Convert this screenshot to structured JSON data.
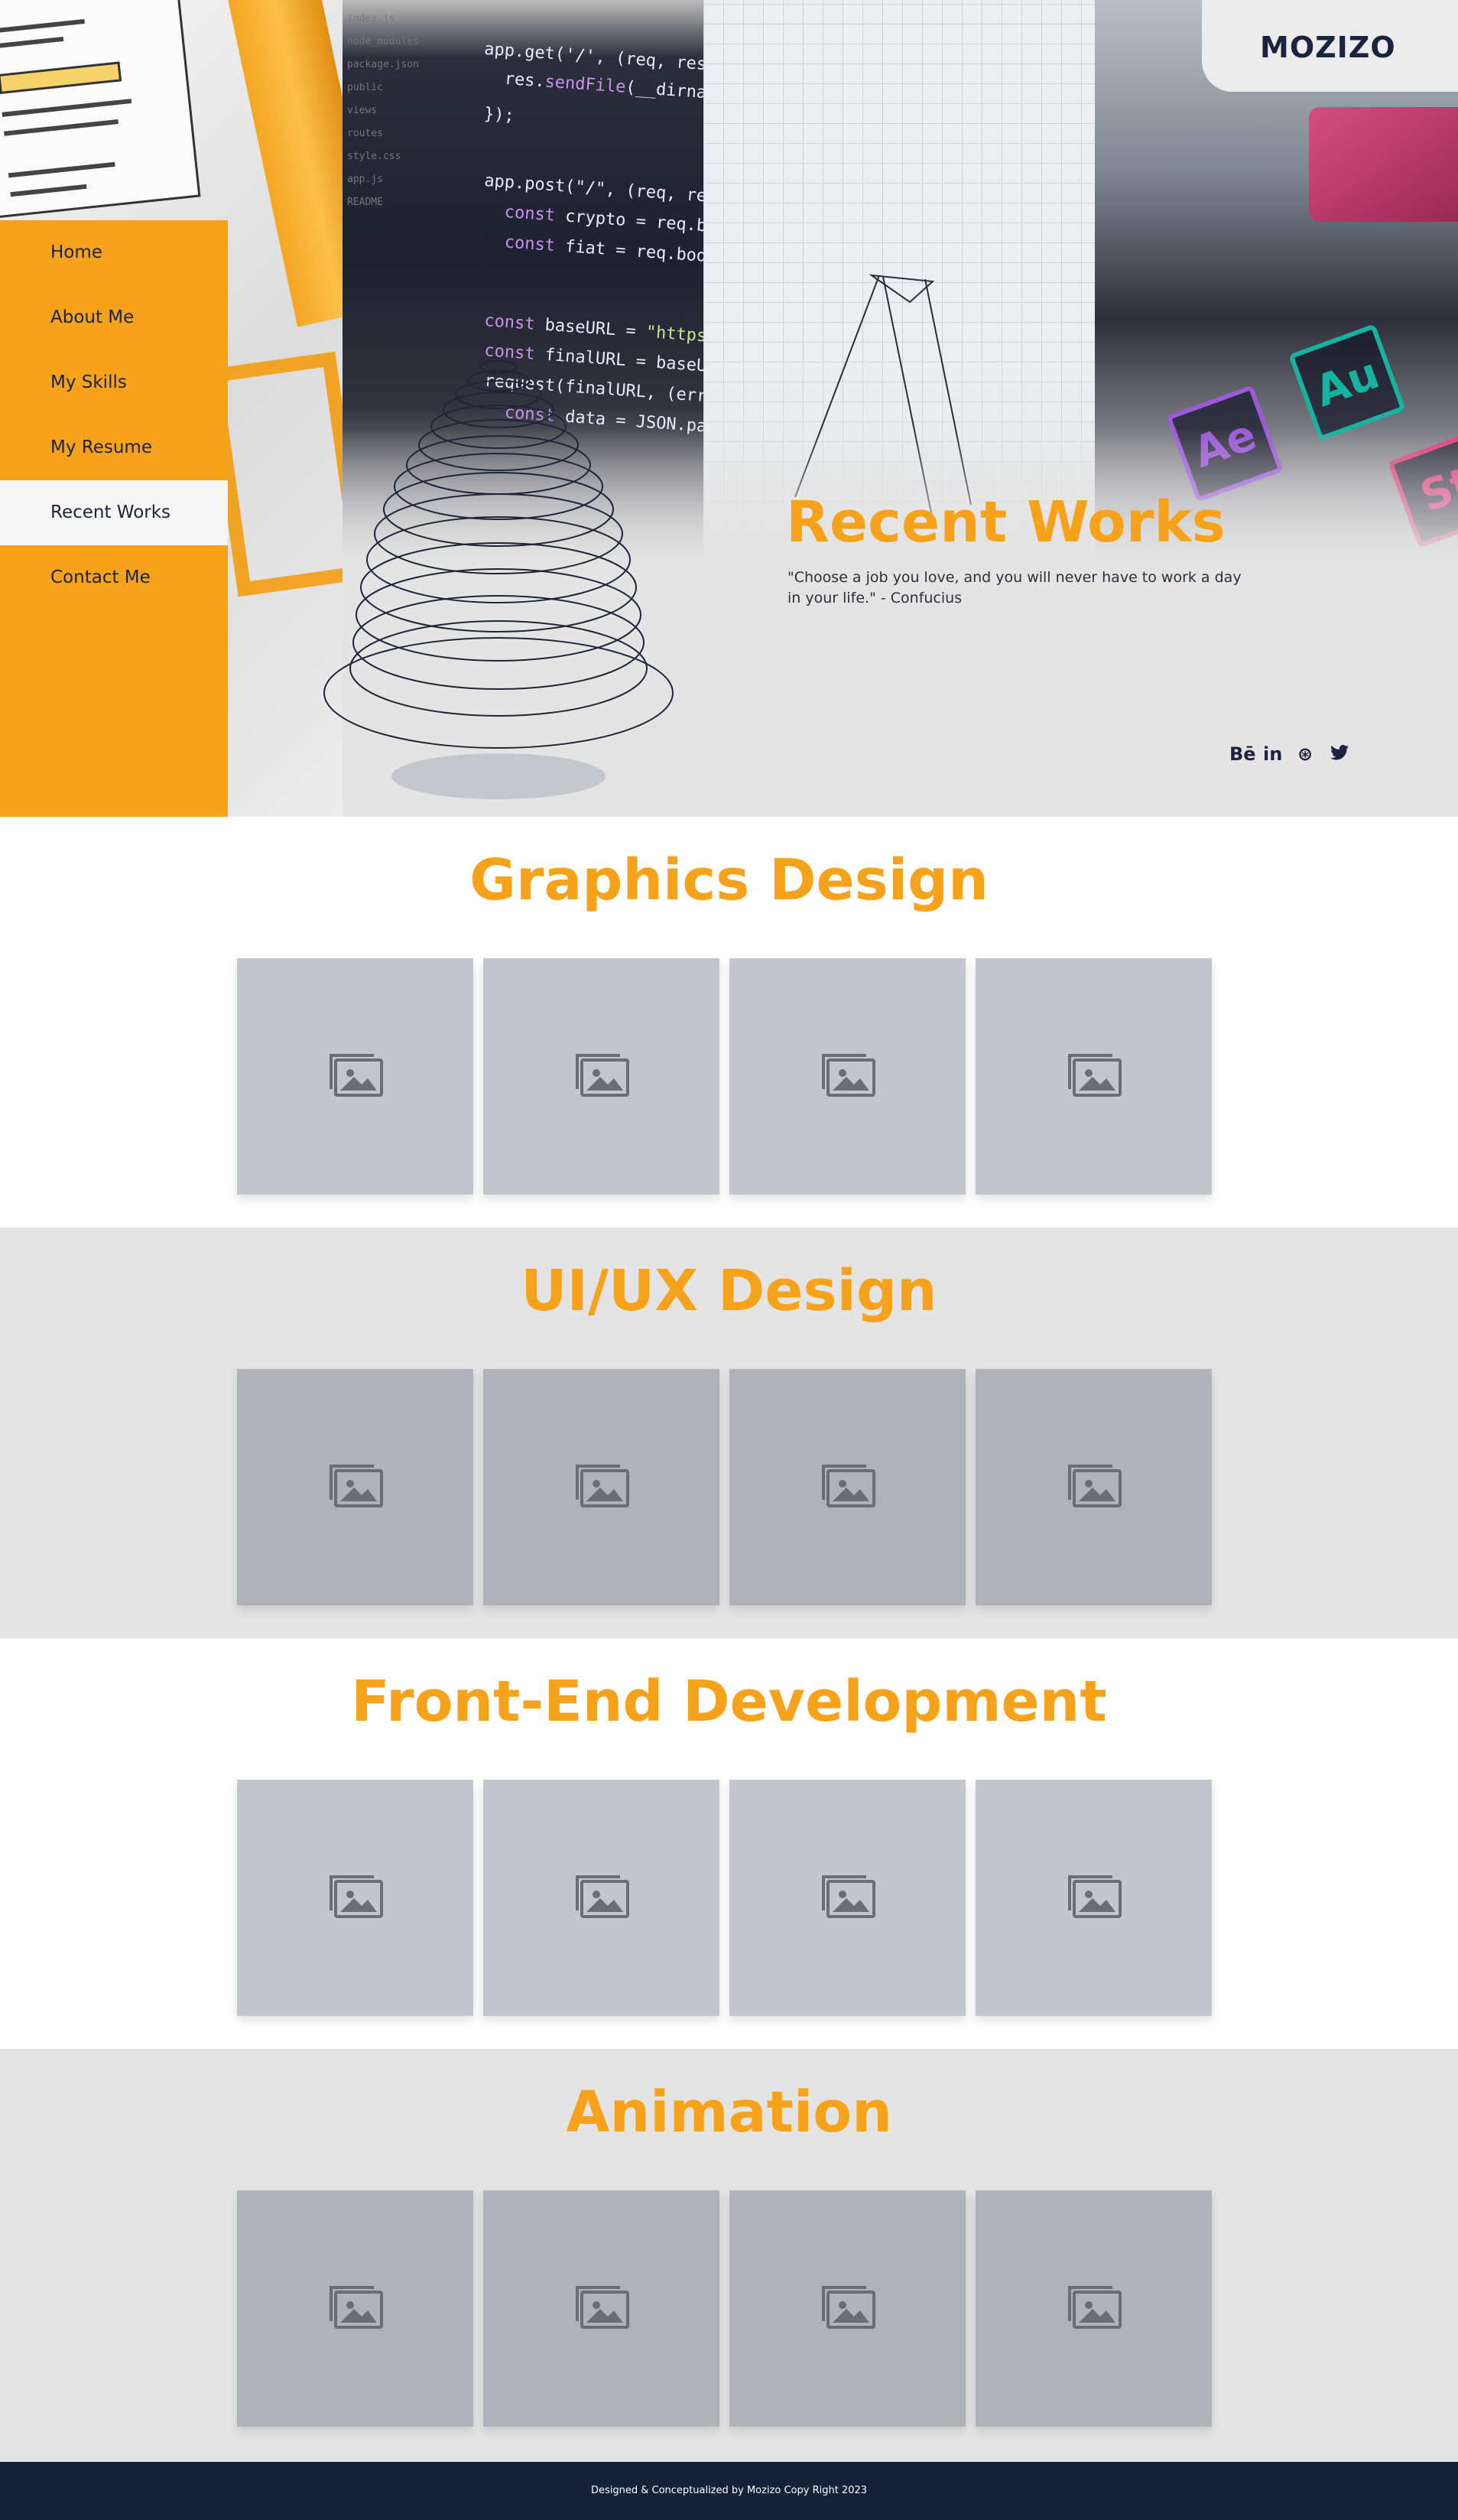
{
  "brand": {
    "logo": "MOZIZO"
  },
  "nav": {
    "items": [
      {
        "label": "Home",
        "active": false
      },
      {
        "label": "About Me",
        "active": false
      },
      {
        "label": "My Skills",
        "active": false
      },
      {
        "label": "My Resume",
        "active": false
      },
      {
        "label": "Recent Works",
        "active": true
      },
      {
        "label": "Contact Me",
        "active": false
      }
    ]
  },
  "hero": {
    "title": "Recent Works",
    "quote": "\"Choose a job you love, and you will never have to work a day in your life.\" - Confucius",
    "socials": [
      {
        "icon": "behance-icon",
        "glyph": "Bē"
      },
      {
        "icon": "linkedin-icon",
        "glyph": "in"
      },
      {
        "icon": "dribbble-icon",
        "glyph": "⊛"
      },
      {
        "icon": "twitter-icon",
        "glyph": "🐦"
      }
    ]
  },
  "sections": [
    {
      "title": "Graphics Design",
      "tiles": 4
    },
    {
      "title": "UI/UX Design",
      "tiles": 4
    },
    {
      "title": "Front-End Development",
      "tiles": 4
    },
    {
      "title": "Animation",
      "tiles": 4
    }
  ],
  "footer": {
    "text": "Designed & Conceptualized by Mozizo Copy Right 2023"
  },
  "colors": {
    "accent": "#f7a21b",
    "navy": "#152039",
    "tile": "#c3c6cc",
    "tile_dark": "#afb3b9"
  }
}
